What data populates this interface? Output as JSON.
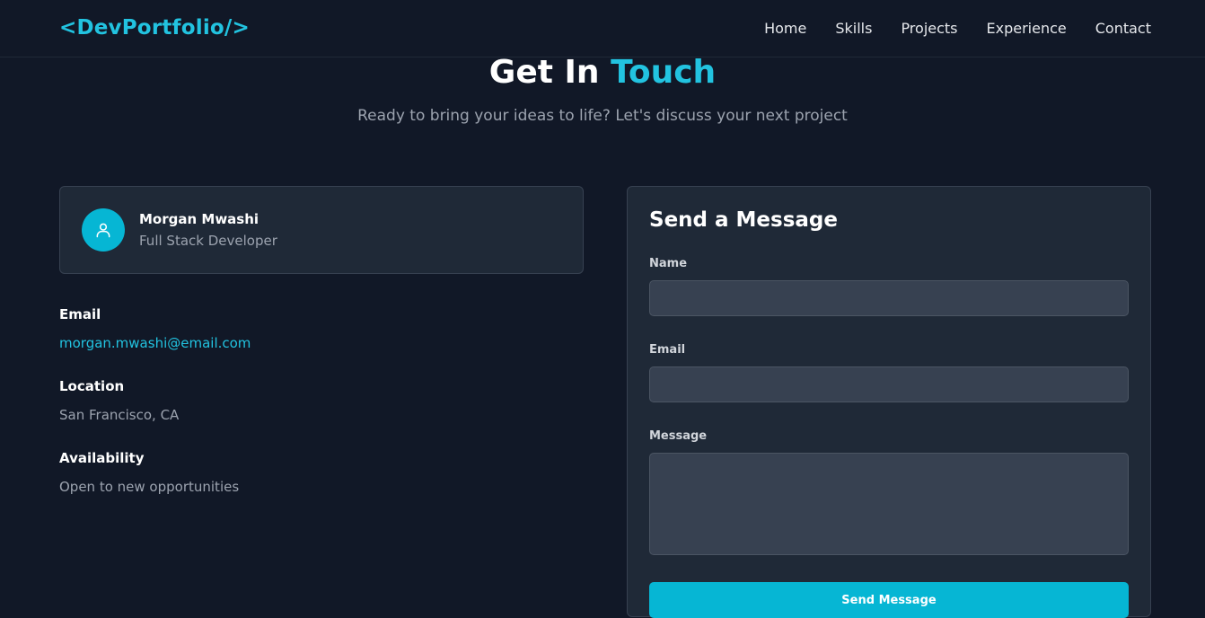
{
  "brand": {
    "logo": "<DevPortfolio/>"
  },
  "nav": {
    "items": [
      {
        "label": "Home"
      },
      {
        "label": "Skills"
      },
      {
        "label": "Projects"
      },
      {
        "label": "Experience"
      },
      {
        "label": "Contact"
      }
    ]
  },
  "hero": {
    "title_main": "Get In",
    "title_accent": "Touch",
    "subtitle": "Ready to bring your ideas to life? Let's discuss your next project"
  },
  "profile": {
    "icon": "user-icon",
    "name": "Morgan Mwashi",
    "role": "Full Stack Developer"
  },
  "contact_info": {
    "email_label": "Email",
    "email_value": "morgan.mwashi@email.com",
    "location_label": "Location",
    "location_value": "San Francisco, CA",
    "availability_label": "Availability",
    "availability_value": "Open to new opportunities"
  },
  "form": {
    "title": "Send a Message",
    "name_label": "Name",
    "name_value": "",
    "email_label": "Email",
    "email_value": "",
    "message_label": "Message",
    "message_value": "",
    "submit_label": "Send Message"
  },
  "colors": {
    "background": "#111827",
    "card": "#1f2937",
    "accent": "#22c3e0",
    "button": "#06b6d4",
    "input": "#374151"
  }
}
